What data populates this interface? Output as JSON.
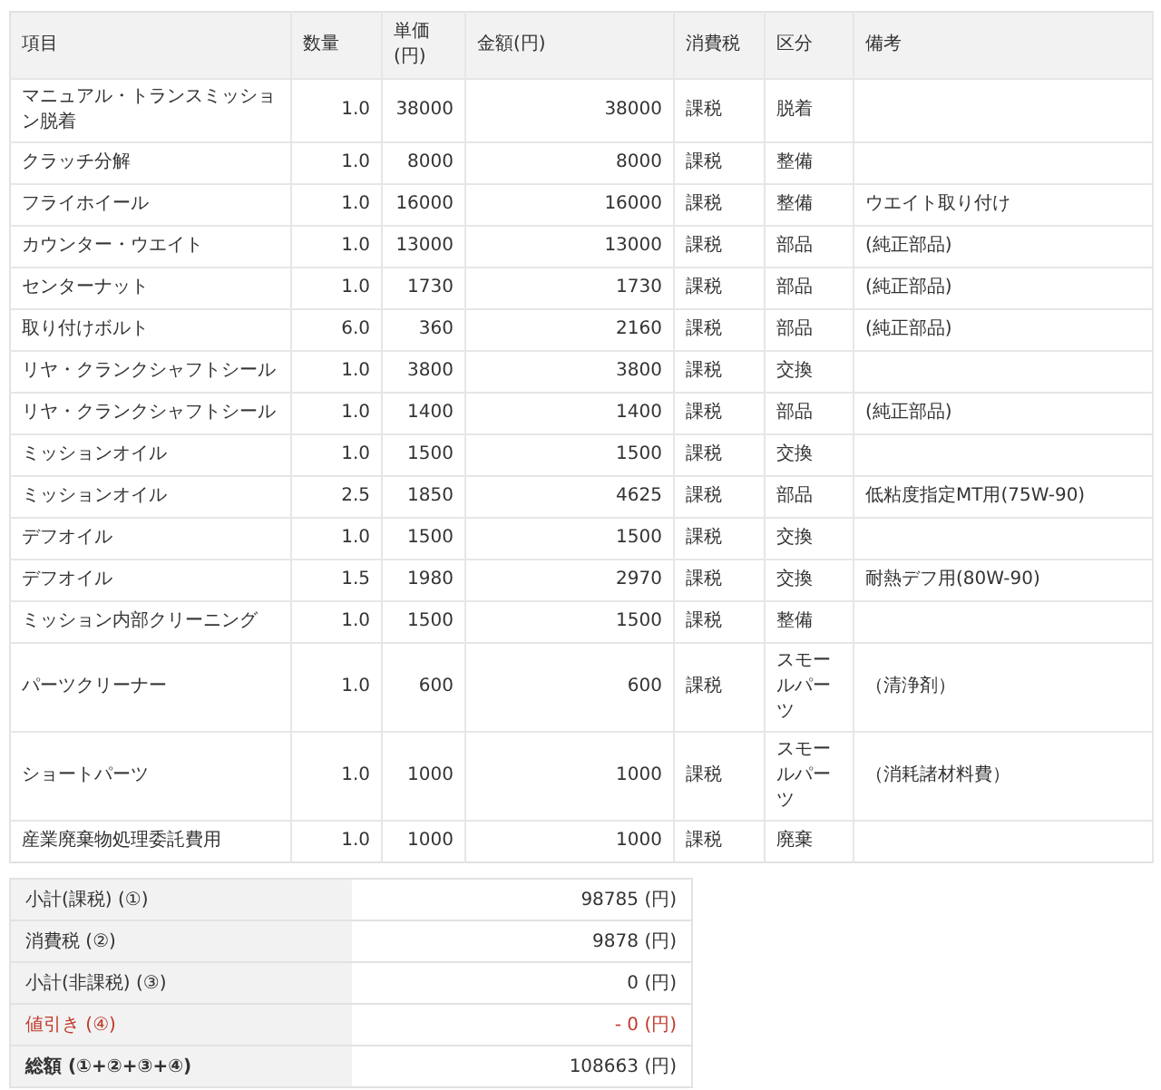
{
  "table": {
    "columns": [
      "項目",
      "数量",
      "単価(円)",
      "金額(円)",
      "消費税",
      "区分",
      "備考"
    ],
    "rows": [
      {
        "item": "マニュアル・トランスミッション脱着",
        "qty": "1.0",
        "unit": "38000",
        "amount": "38000",
        "tax": "課税",
        "kind": "脱着",
        "note": ""
      },
      {
        "item": "クラッチ分解",
        "qty": "1.0",
        "unit": "8000",
        "amount": "8000",
        "tax": "課税",
        "kind": "整備",
        "note": ""
      },
      {
        "item": "フライホイール",
        "qty": "1.0",
        "unit": "16000",
        "amount": "16000",
        "tax": "課税",
        "kind": "整備",
        "note": "ウエイト取り付け"
      },
      {
        "item": "カウンター・ウエイト",
        "qty": "1.0",
        "unit": "13000",
        "amount": "13000",
        "tax": "課税",
        "kind": "部品",
        "note": "(純正部品)"
      },
      {
        "item": "センターナット",
        "qty": "1.0",
        "unit": "1730",
        "amount": "1730",
        "tax": "課税",
        "kind": "部品",
        "note": "(純正部品)"
      },
      {
        "item": "取り付けボルト",
        "qty": "6.0",
        "unit": "360",
        "amount": "2160",
        "tax": "課税",
        "kind": "部品",
        "note": "(純正部品)"
      },
      {
        "item": "リヤ・クランクシャフトシール",
        "qty": "1.0",
        "unit": "3800",
        "amount": "3800",
        "tax": "課税",
        "kind": "交換",
        "note": ""
      },
      {
        "item": "リヤ・クランクシャフトシール",
        "qty": "1.0",
        "unit": "1400",
        "amount": "1400",
        "tax": "課税",
        "kind": "部品",
        "note": "(純正部品)"
      },
      {
        "item": "ミッションオイル",
        "qty": "1.0",
        "unit": "1500",
        "amount": "1500",
        "tax": "課税",
        "kind": "交換",
        "note": ""
      },
      {
        "item": "ミッションオイル",
        "qty": "2.5",
        "unit": "1850",
        "amount": "4625",
        "tax": "課税",
        "kind": "部品",
        "note": "低粘度指定MT用(75W-90)"
      },
      {
        "item": "デフオイル",
        "qty": "1.0",
        "unit": "1500",
        "amount": "1500",
        "tax": "課税",
        "kind": "交換",
        "note": ""
      },
      {
        "item": "デフオイル",
        "qty": "1.5",
        "unit": "1980",
        "amount": "2970",
        "tax": "課税",
        "kind": "交換",
        "note": "耐熱デフ用(80W-90)"
      },
      {
        "item": "ミッション内部クリーニング",
        "qty": "1.0",
        "unit": "1500",
        "amount": "1500",
        "tax": "課税",
        "kind": "整備",
        "note": ""
      },
      {
        "item": "パーツクリーナー",
        "qty": "1.0",
        "unit": "600",
        "amount": "600",
        "tax": "課税",
        "kind": "スモールパーツ",
        "note": "（清浄剤）"
      },
      {
        "item": "ショートパーツ",
        "qty": "1.0",
        "unit": "1000",
        "amount": "1000",
        "tax": "課税",
        "kind": "スモールパーツ",
        "note": "（消耗諸材料費）"
      },
      {
        "item": "産業廃棄物処理委託費用",
        "qty": "1.0",
        "unit": "1000",
        "amount": "1000",
        "tax": "課税",
        "kind": "廃棄",
        "note": ""
      }
    ]
  },
  "summary": [
    {
      "kind": "normal",
      "label": "小計(課税) (①)",
      "value": "98785",
      "unit": "(円)"
    },
    {
      "kind": "normal",
      "label": "消費税 (②)",
      "value": "9878",
      "unit": "(円)"
    },
    {
      "kind": "normal",
      "label": "小計(非課税) (③)",
      "value": "0",
      "unit": "(円)"
    },
    {
      "kind": "discount",
      "label": "値引き (④)",
      "value": "- 0",
      "unit": "(円)"
    },
    {
      "kind": "total",
      "label": "総額 (①+②+③+④)",
      "value": "108663",
      "unit": "(円)"
    }
  ]
}
